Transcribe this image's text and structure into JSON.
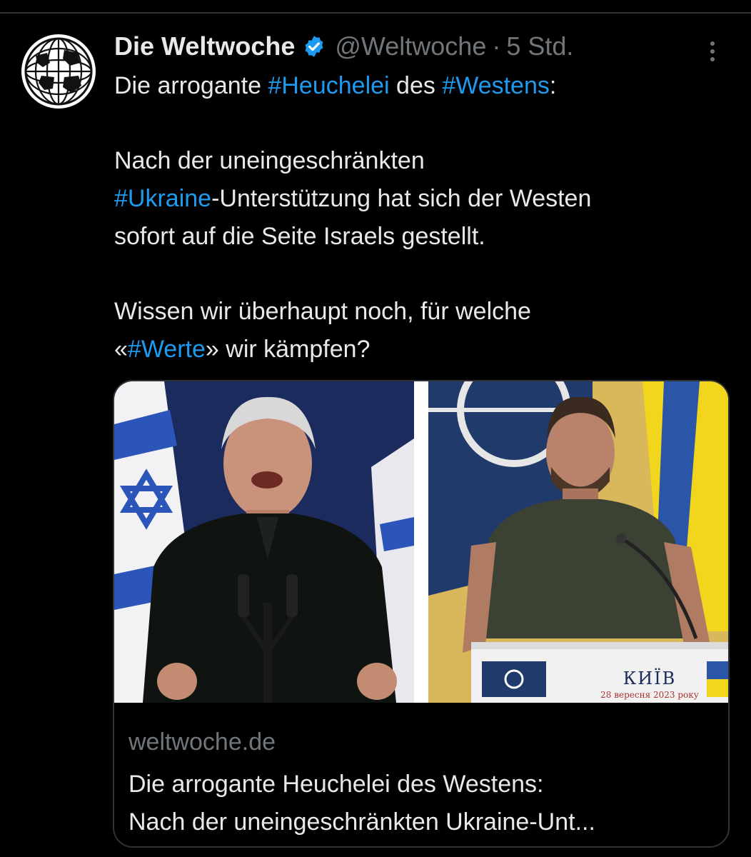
{
  "tweet": {
    "author": {
      "display_name": "Die Weltwoche",
      "handle": "@Weltwoche",
      "verified_icon": "verified-badge-icon",
      "avatar_icon": "globe-logo-icon"
    },
    "separator": "·",
    "timestamp": "5 Std.",
    "more_icon": "more-options-icon",
    "text": {
      "l1_pre": "Die arrogante ",
      "l1_tag1": "#Heuchelei",
      "l1_mid": " des ",
      "l1_tag2": "#Westens",
      "l1_post": ":",
      "l2": "Nach der uneingeschränkten",
      "l3_tag": "#Ukraine",
      "l3_post": "-Unterstützung hat sich der Westen",
      "l4": "sofort auf die Seite Israels gestellt.",
      "l5": "Wissen wir überhaupt noch, für welche",
      "l6_pre": "«",
      "l6_tag": "#Werte",
      "l6_post": "» wir kämpfen?"
    },
    "card": {
      "podium_label": "КИЇВ",
      "podium_date": "28 вересня 2023 року",
      "domain": "weltwoche.de",
      "title_line1": "Die arrogante Heuchelei des Westens:",
      "title_line2": "Nach der uneingeschränkten Ukraine-Unt..."
    }
  },
  "colors": {
    "background": "#000000",
    "text": "#e7e9ea",
    "muted": "#71767b",
    "link": "#1d9bf0",
    "border": "#2f3336"
  }
}
